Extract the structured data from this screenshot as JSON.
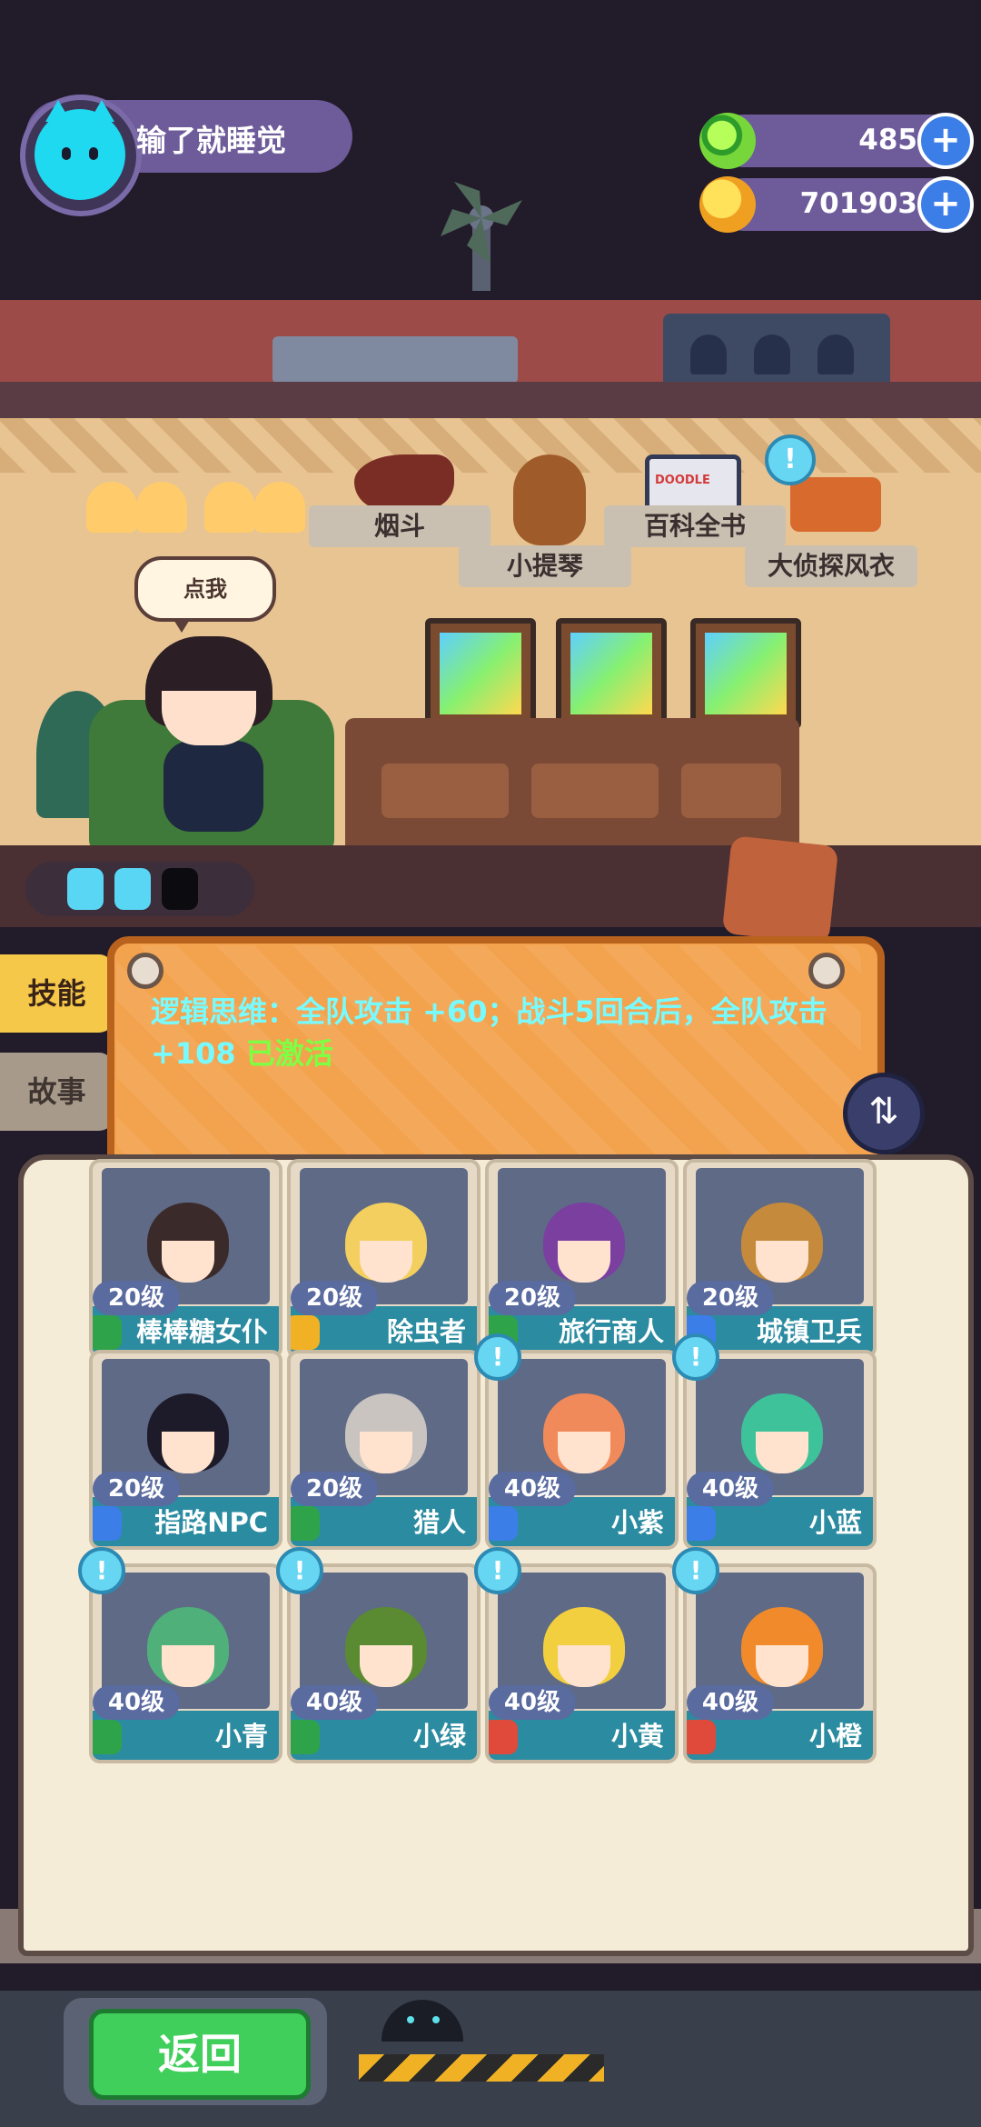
{
  "player": {
    "name": "输了就睡觉"
  },
  "currencies": [
    {
      "icon": "green-gem-icon",
      "value": "485"
    },
    {
      "icon": "gold-coin-icon",
      "value": "701903"
    }
  ],
  "scene": {
    "speech_bubble": "点我",
    "shelf_items": [
      "烟斗",
      "小提琴",
      "百科全书",
      "大侦探风衣"
    ],
    "book_cover_text": "DOODLE"
  },
  "tabs": {
    "skill": "技能",
    "story": "故事"
  },
  "skill": {
    "text": "逻辑思维：全队攻击 +60；战斗5回合后，全队攻击 +108",
    "status": "已激活"
  },
  "characters": [
    {
      "name": "棒棒糖女仆",
      "level": "20级",
      "role_color": "#2fa34a",
      "hair": "#3b2a2a",
      "alert": false
    },
    {
      "name": "除虫者",
      "level": "20级",
      "role_color": "#f0b224",
      "hair": "#f2cf5e",
      "alert": false
    },
    {
      "name": "旅行商人",
      "level": "20级",
      "role_color": "#2fa34a",
      "hair": "#7b3fa0",
      "alert": false
    },
    {
      "name": "城镇卫兵",
      "level": "20级",
      "role_color": "#3b7ee8",
      "hair": "#c58a3c",
      "alert": false
    },
    {
      "name": "指路NPC",
      "level": "20级",
      "role_color": "#3b7ee8",
      "hair": "#1d1b2a",
      "alert": false
    },
    {
      "name": "猎人",
      "level": "20级",
      "role_color": "#2fa34a",
      "hair": "#c9c4c0",
      "alert": false
    },
    {
      "name": "小紫",
      "level": "40级",
      "role_color": "#3b7ee8",
      "hair": "#f08a5a",
      "alert": true
    },
    {
      "name": "小蓝",
      "level": "40级",
      "role_color": "#3b7ee8",
      "hair": "#3ec29a",
      "alert": true
    },
    {
      "name": "小青",
      "level": "40级",
      "role_color": "#2fa34a",
      "hair": "#4fb07a",
      "alert": true
    },
    {
      "name": "小绿",
      "level": "40级",
      "role_color": "#2fa34a",
      "hair": "#5a8a32",
      "alert": true
    },
    {
      "name": "小黄",
      "level": "40级",
      "role_color": "#e04a3a",
      "hair": "#f2cf3e",
      "alert": true
    },
    {
      "name": "小橙",
      "level": "40级",
      "role_color": "#e04a3a",
      "hair": "#f08a2a",
      "alert": true
    }
  ],
  "energy": {
    "filled": 2,
    "total": 3
  },
  "bottom": {
    "back_label": "返回"
  },
  "alert_glyph": "!"
}
